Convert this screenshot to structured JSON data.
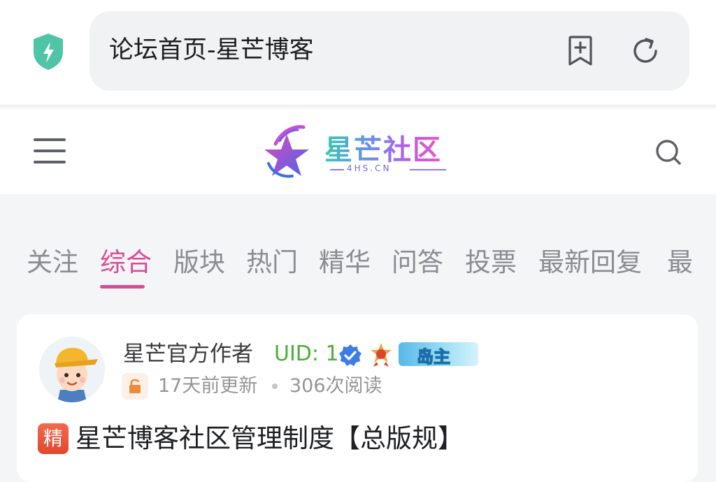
{
  "browser": {
    "url_title": "论坛首页-星芒博客",
    "shield_color": "#4fc4a7"
  },
  "site_header": {
    "logo_text": "星芒社区",
    "logo_subtext": "4HS.CN"
  },
  "tabs": [
    {
      "label": "关注",
      "active": false
    },
    {
      "label": "综合",
      "active": true
    },
    {
      "label": "版块",
      "active": false
    },
    {
      "label": "热门",
      "active": false
    },
    {
      "label": "精华",
      "active": false
    },
    {
      "label": "问答",
      "active": false
    },
    {
      "label": "投票",
      "active": false
    },
    {
      "label": "最新回复",
      "active": false
    },
    {
      "label": "最",
      "active": false
    }
  ],
  "accent_color": "#d84c93",
  "post": {
    "author": "星芒官方作者",
    "uid": "UID: 1",
    "island_badge": "岛主",
    "updated": "17天前更新",
    "views": "306次阅读",
    "essence_tag": "精",
    "title": "星芒博客社区管理制度【总版规】"
  }
}
